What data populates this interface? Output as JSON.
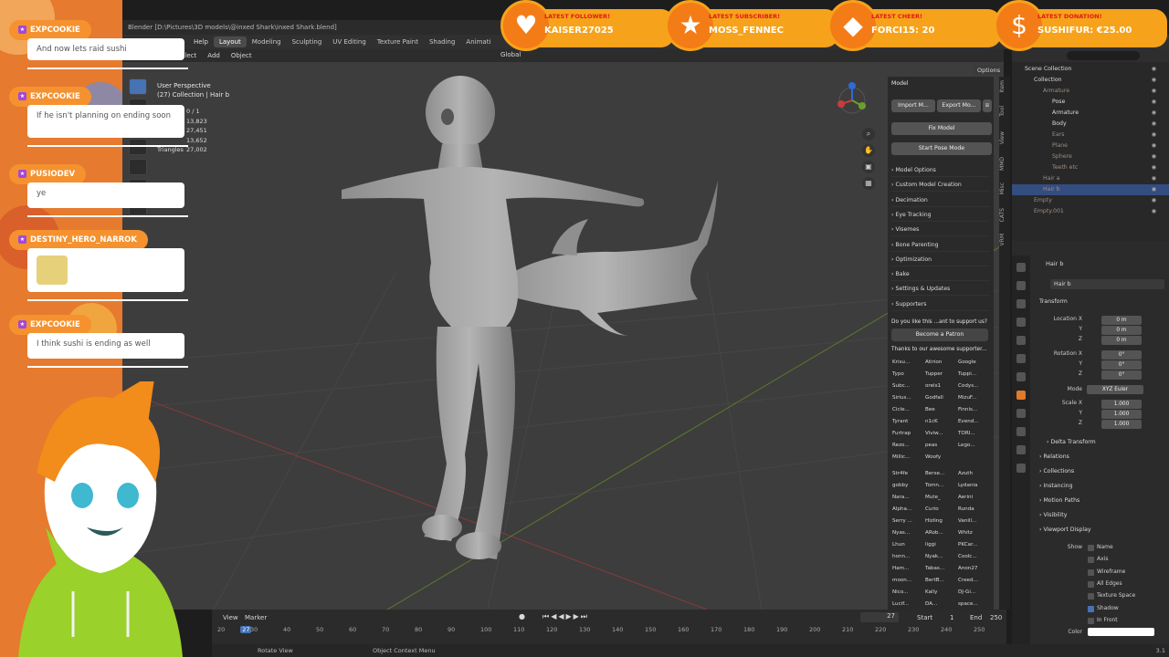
{
  "blender": {
    "title": "Blender [D:\\Pictures\\3D models\\@inxed Shark\\inxed Shark.blend]",
    "menu": [
      "ender",
      "Window",
      "Help"
    ],
    "workspaces": [
      "Layout",
      "Modeling",
      "Sculpting",
      "UV Editing",
      "Texture Paint",
      "Shading",
      "Animati"
    ],
    "active_workspace": "Layout",
    "viewport_header": [
      "ode",
      "View",
      "Select",
      "Add",
      "Object"
    ],
    "transform_orientation": "Global",
    "options_label": "Options",
    "view_name": "User Perspective",
    "collection_info": "(27) Collection | Hair b",
    "stats": [
      {
        "label": "",
        "value": "0 / 1"
      },
      {
        "label": "",
        "value": "13,823"
      },
      {
        "label": "",
        "value": "27,451"
      },
      {
        "label": "",
        "value": "13,652"
      },
      {
        "label": "Triangles",
        "value": "27,002"
      }
    ]
  },
  "cats": {
    "model_header": "Model",
    "import_label": "Import M...",
    "export_label": "Export Mo...",
    "fix_model": "Fix Model",
    "start_pose_mode": "Start Pose Mode",
    "sections": [
      "Model Options",
      "Custom Model Creation",
      "Decimation",
      "Eye Tracking",
      "Visemes",
      "Bone Parenting",
      "Optimization",
      "Bake",
      "Settings & Updates",
      "Supporters"
    ],
    "support_text": "Do you like this ...ant to support us?",
    "become_patron": "Become a Patron",
    "thanks": "Thanks to our awesome supporter...",
    "supporters_a": [
      "Krisu...",
      "Atirion",
      "Google",
      "Typo",
      "Tupper",
      "Tuppi...",
      "Subc...",
      "orels1",
      "Codys...",
      "Sirius...",
      "Godfall",
      "MizuF...",
      "Cicle...",
      "Bee",
      "Finnis...",
      "Tyrant",
      "n1cK",
      "Evend...",
      "Furtrap",
      "Viviw...",
      "TORI...",
      "Rezo...",
      "peas",
      "Lego...",
      "Millic...",
      "Woofy"
    ],
    "supporters_b": [
      "Str4fe",
      "Berse...",
      "Azuth",
      "gobby",
      "Tomn...",
      "Lydania",
      "Nara...",
      "Mute_",
      "Aerini",
      "Alpha...",
      "Curio",
      "Runda",
      "Serry ...",
      "Hizling",
      "Vanill...",
      "Nyas...",
      "ARob...",
      "Whitz",
      "Lhun",
      "liggi",
      "PKCar...",
      "honn...",
      "Nyak...",
      "Coolc...",
      "Ham...",
      "Tabas...",
      "Anon27",
      "moon...",
      "BertB...",
      "Creed...",
      "Nico...",
      "Kally",
      "DJ-Gi...",
      "Lucif...",
      "DA...",
      "space...",
      "Wishes",
      "Vvrei",
      "Lexiii..."
    ],
    "side_tabs": [
      "Item",
      "Tool",
      "View",
      "MMD",
      "Misc",
      "CATS",
      "VRM"
    ]
  },
  "outliner": {
    "rows": [
      {
        "label": "Scene Collection",
        "indent": 0,
        "dim": false
      },
      {
        "label": "Collection",
        "indent": 1,
        "dim": false
      },
      {
        "label": "Armature",
        "indent": 2,
        "dim": true
      },
      {
        "label": "Pose",
        "indent": 3,
        "dim": false
      },
      {
        "label": "Armature",
        "indent": 3,
        "dim": false
      },
      {
        "label": "Body",
        "indent": 3,
        "dim": false
      },
      {
        "label": "Ears",
        "indent": 3,
        "dim": true
      },
      {
        "label": "Plane",
        "indent": 3,
        "dim": true
      },
      {
        "label": "Sphere",
        "indent": 3,
        "dim": true
      },
      {
        "label": "Teeth etc",
        "indent": 3,
        "dim": true
      },
      {
        "label": "Hair a",
        "indent": 2,
        "dim": true
      },
      {
        "label": "Hair b",
        "indent": 2,
        "dim": true,
        "selected": true
      },
      {
        "label": "Empty",
        "indent": 1,
        "dim": true
      },
      {
        "label": "Empty.001",
        "indent": 1,
        "dim": true
      }
    ]
  },
  "props": {
    "object_name": "Hair b",
    "object_name2": "Hair b",
    "transform": "Transform",
    "location_label": "Location X",
    "rotation_label": "Rotation X",
    "mode_label": "Mode",
    "mode_value": "XYZ Euler",
    "scale_label": "Scale X",
    "axis_y": "Y",
    "axis_z": "Z",
    "loc": [
      "0 m",
      "0 m",
      "0 m"
    ],
    "rot": [
      "0°",
      "0°",
      "0°"
    ],
    "scale": [
      "1.000",
      "1.000",
      "1.000"
    ],
    "sections": [
      "Delta Transform",
      "Relations",
      "Collections",
      "Instancing",
      "Motion Paths",
      "Visibility",
      "Viewport Display"
    ],
    "show_label": "Show",
    "checks": [
      {
        "label": "Name",
        "on": false
      },
      {
        "label": "Axis",
        "on": false
      },
      {
        "label": "Wireframe",
        "on": false
      },
      {
        "label": "All Edges",
        "on": false
      },
      {
        "label": "Texture Space",
        "on": false
      },
      {
        "label": "Shadow",
        "on": true
      },
      {
        "label": "In Front",
        "on": false
      }
    ],
    "color_label": "Color"
  },
  "timeline": {
    "view": "View",
    "marker": "Marker",
    "current_frame": "27",
    "start_label": "Start",
    "start": "1",
    "end_label": "End",
    "end": "250",
    "ticks": [
      "20",
      "27",
      "30",
      "40",
      "50",
      "60",
      "70",
      "80",
      "90",
      "100",
      "110",
      "120",
      "130",
      "140",
      "150",
      "160",
      "170",
      "180",
      "190",
      "200",
      "210",
      "220",
      "230",
      "240",
      "250"
    ]
  },
  "status": {
    "rotate_view": "Rotate View",
    "context_menu": "Object Context Menu",
    "version": "3.1"
  },
  "overlay": {
    "chat": [
      {
        "name": "EXPCOOKIE",
        "message": "And now lets raid sushi"
      },
      {
        "name": "EXPCOOKIE",
        "message": "If he isn't planning on ending soon"
      },
      {
        "name": "PUSIODEV",
        "message": "ye"
      },
      {
        "name": "DESTINY_HERO_NARROK",
        "message": ""
      },
      {
        "name": "EXPCOOKIE",
        "message": "I think sushi is ending as well"
      }
    ],
    "alerts": [
      {
        "label": "LATEST FOLLOWER!",
        "value": "KAISER27025",
        "icon": "heart-icon"
      },
      {
        "label": "LATEST SUBSCRIBER!",
        "value": "MOSS_FENNEC",
        "icon": "star-icon"
      },
      {
        "label": "LATEST CHEER!",
        "value": "FORCI15: 20",
        "icon": "diamond-icon"
      },
      {
        "label": "LATEST DONATION!",
        "value": "SUSHIFUR: €25.00",
        "icon": "dollar-icon"
      }
    ],
    "colors": {
      "alert_bar": "#f7a21b",
      "alert_circle": "#f47c16",
      "chat_name_bg": "#f5922f"
    }
  }
}
